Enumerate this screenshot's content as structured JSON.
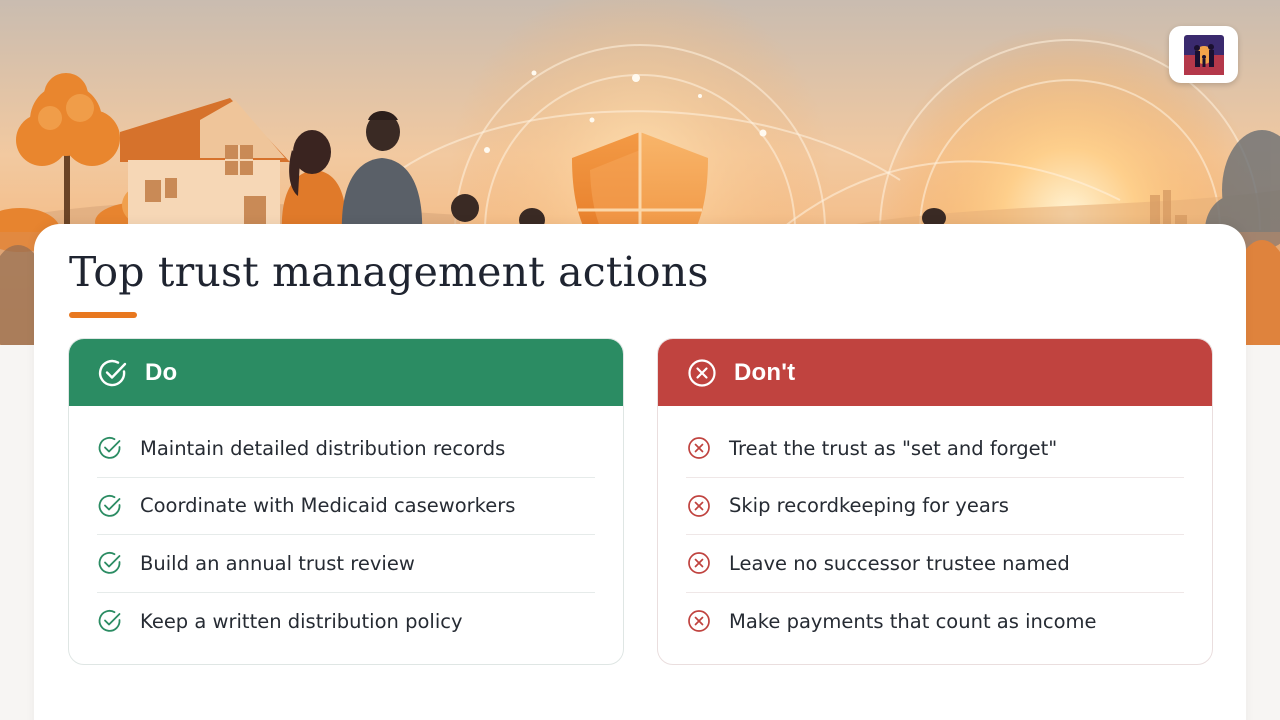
{
  "title": "Top trust management actions",
  "colors": {
    "accent": "#e8781f",
    "do": "#2b8c63",
    "dont": "#c0433f",
    "text": "#262b33"
  },
  "do": {
    "label": "Do",
    "icon": "check-circle-icon",
    "items": [
      "Maintain detailed distribution records",
      "Coordinate with Medicaid caseworkers",
      "Build an annual trust review",
      "Keep a written distribution policy"
    ]
  },
  "dont": {
    "label": "Don't",
    "icon": "x-circle-icon",
    "items": [
      "Treat the trust as \"set and forget\"",
      "Skip recordkeeping for years",
      "Leave no successor trustee named",
      "Make payments that count as income"
    ]
  }
}
